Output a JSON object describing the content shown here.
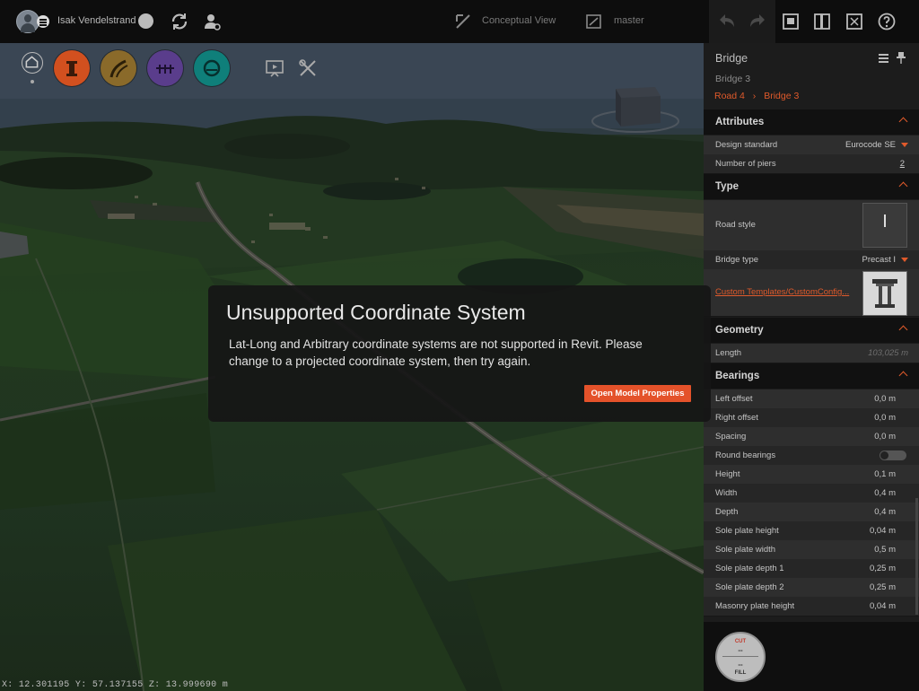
{
  "topbar": {
    "user_name": "Isak Vendelstrand",
    "view_name": "Conceptual View",
    "branch": "master"
  },
  "panel": {
    "title": "Bridge",
    "subtitle": "Bridge 3",
    "breadcrumb": [
      "Road 4",
      "Bridge 3"
    ],
    "sections": {
      "attributes": "Attributes",
      "type": "Type",
      "geometry": "Geometry",
      "bearings": "Bearings"
    },
    "attributes": {
      "design_standard_label": "Design standard",
      "design_standard_value": "Eurocode SE",
      "piers_label": "Number of piers",
      "piers_value": "2"
    },
    "type": {
      "road_style_label": "Road style",
      "bridge_type_label": "Bridge type",
      "bridge_type_value": "Precast I",
      "template_link": "Custom Templates/CustomConfig..."
    },
    "geometry": {
      "length_label": "Length",
      "length_value": "103,025 m"
    },
    "bearings": [
      {
        "label": "Left offset",
        "value": "0,0 m"
      },
      {
        "label": "Right offset",
        "value": "0,0 m"
      },
      {
        "label": "Spacing",
        "value": "0,0 m"
      },
      {
        "label": "Round bearings",
        "value": ""
      },
      {
        "label": "Height",
        "value": "0,1 m"
      },
      {
        "label": "Width",
        "value": "0,4 m"
      },
      {
        "label": "Depth",
        "value": "0,4 m"
      },
      {
        "label": "Sole plate height",
        "value": "0,04 m"
      },
      {
        "label": "Sole plate width",
        "value": "0,5 m"
      },
      {
        "label": "Sole plate depth 1",
        "value": "0,25 m"
      },
      {
        "label": "Sole plate depth 2",
        "value": "0,25 m"
      },
      {
        "label": "Masonry plate height",
        "value": "0,04 m"
      }
    ]
  },
  "dialog": {
    "title": "Unsupported Coordinate System",
    "message": "Lat-Long and Arbitrary coordinate systems are not supported in Revit.  Please change to a projected coordinate system, then try again.",
    "button": "Open Model Properties"
  },
  "status": {
    "coordinates": "X: 12.301195 Y: 57.137155 Z: 13.999690 m"
  },
  "cutfill": {
    "cut_label": "CUT",
    "cut_value": "--",
    "fill_label": "FILL",
    "fill_value": "--"
  },
  "colors": {
    "accent": "#e4522a",
    "bubble_terrain": "#d2501f",
    "bubble_road": "#8a6a2a",
    "bubble_bridge": "#5a3d8c",
    "bubble_tunnel": "#0f7f7a"
  }
}
